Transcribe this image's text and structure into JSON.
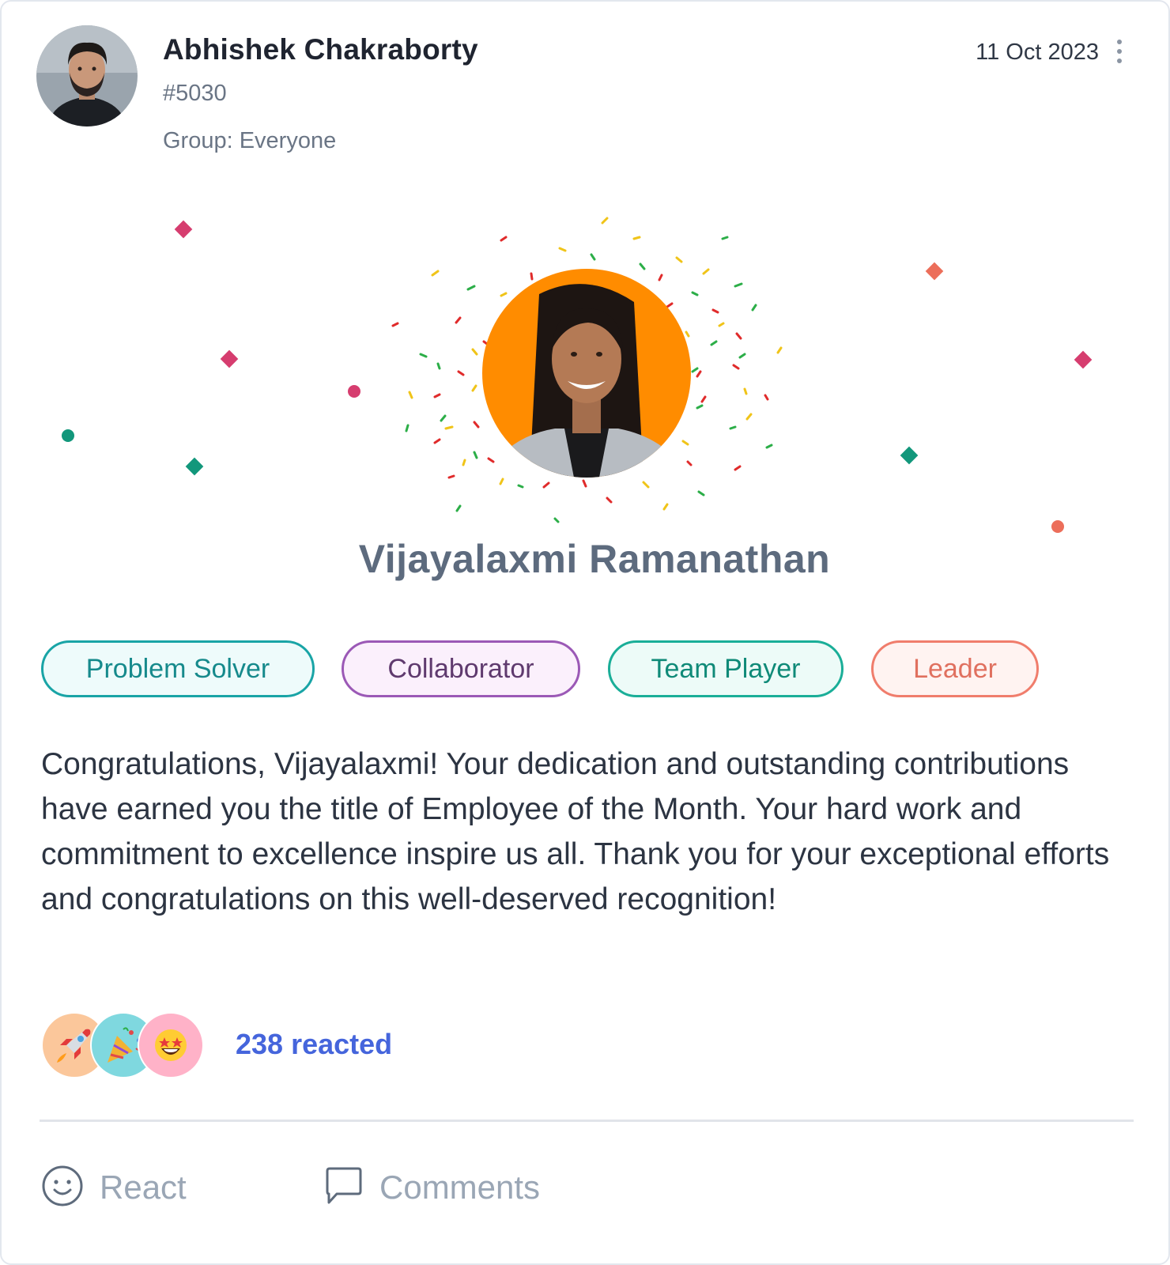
{
  "post": {
    "author_name": "Abhishek Chakraborty",
    "post_id": "#5030",
    "group": "Group: Everyone",
    "date": "11 Oct 2023"
  },
  "recipient": {
    "name": "Vijayalaxmi Ramanathan",
    "avatar_background": "#ff8c00"
  },
  "tags": [
    {
      "label": "Problem Solver",
      "border": "#19a4a6",
      "fill": "#eefbfb",
      "text": "#168a8c"
    },
    {
      "label": "Collaborator",
      "border": "#9b59b6",
      "fill": "#fbf0fc",
      "text": "#5f3a6e"
    },
    {
      "label": "Team Player",
      "border": "#1aae98",
      "fill": "#edfbf8",
      "text": "#0f8a78"
    },
    {
      "label": "Leader",
      "border": "#f07d6c",
      "fill": "#fff3f1",
      "text": "#e0705f"
    }
  ],
  "message": "Congratulations, Vijayalaxmi! Your dedication and outstanding contributions have earned you the title of Employee of the Month. Your hard work and commitment to excellence inspire us all. Thank you for your exceptional efforts and congratulations on this well-deserved recognition!",
  "reactions": {
    "emojis": [
      {
        "icon": "rocket",
        "bg": "#fbc79b"
      },
      {
        "icon": "party-popper",
        "bg": "#7fd8df"
      },
      {
        "icon": "star-struck",
        "bg": "#ffb2c8"
      }
    ],
    "count_text": "238 reacted"
  },
  "actions": {
    "react_label": "React",
    "comments_label": "Comments"
  }
}
